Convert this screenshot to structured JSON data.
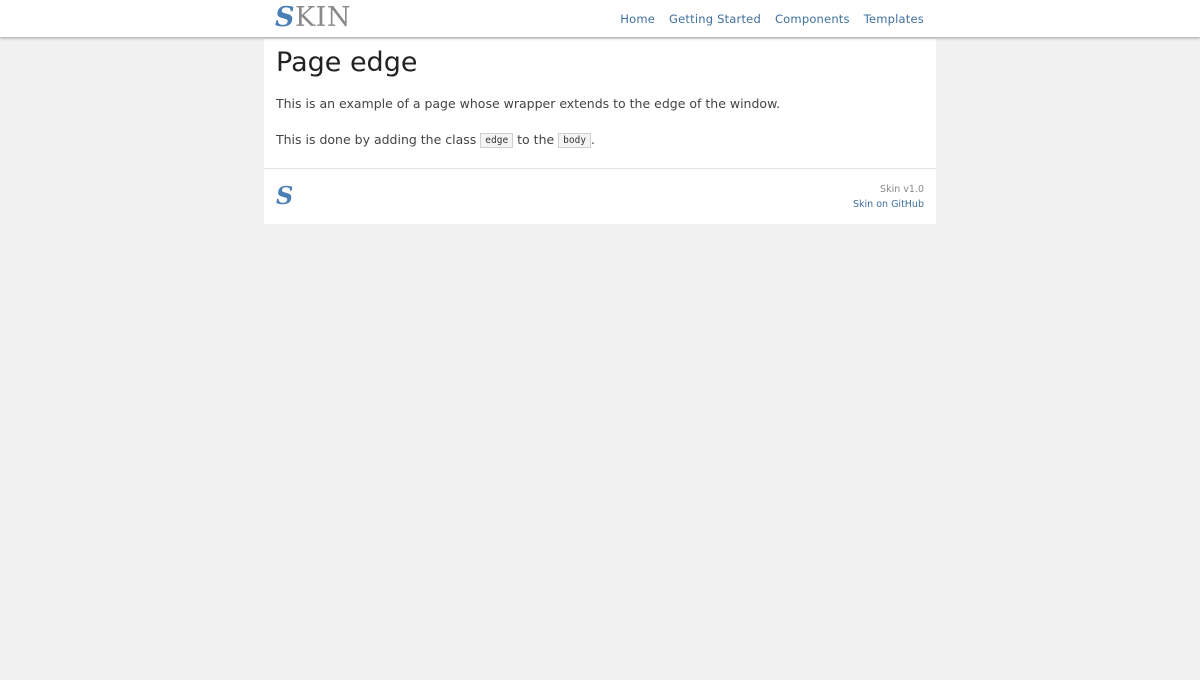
{
  "header": {
    "logo_first": "S",
    "logo_rest": "KIN",
    "nav": [
      "Home",
      "Getting Started",
      "Components",
      "Templates"
    ]
  },
  "main": {
    "title": "Page edge",
    "paragraph1": "This is an example of a page whose wrapper extends to the edge of the window.",
    "paragraph2_before": "This is done by adding the class ",
    "code1": "edge",
    "paragraph2_middle": " to the ",
    "code2": "body",
    "paragraph2_after": "."
  },
  "footer": {
    "logo": "S",
    "version": "Skin v1.0",
    "github_link": "Skin on GitHub"
  },
  "colors": {
    "accent": "#4a7fb5",
    "link": "#3f6f9c",
    "background": "#f1f1f1"
  },
  "icons": {
    "logo": "skin-logo-icon",
    "footer_logo": "skin-s-logo-icon"
  }
}
